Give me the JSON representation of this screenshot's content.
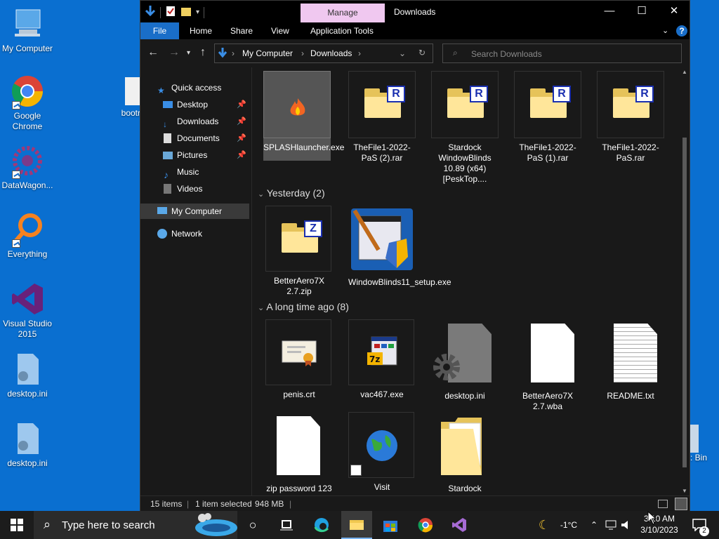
{
  "desktop": {
    "icons": [
      "My Computer",
      "Google Chrome",
      "DataWagon...",
      "Everything",
      "Visual Studio 2015",
      "desktop.ini",
      "desktop.ini"
    ],
    "partial_bootr": "bootr",
    "partial_bin": ": Bin"
  },
  "window": {
    "manage_tab": "Manage",
    "title": "Downloads",
    "ribbon_tabs": [
      "File",
      "Home",
      "Share",
      "View",
      "Application Tools"
    ],
    "breadcrumb": [
      "My Computer",
      "Downloads"
    ],
    "search_placeholder": "Search Downloads"
  },
  "nav": {
    "quick_access": "Quick access",
    "items": [
      "Desktop",
      "Downloads",
      "Documents",
      "Pictures",
      "Music",
      "Videos"
    ],
    "my_computer": "My Computer",
    "network": "Network"
  },
  "content": {
    "today_items": [
      "SPLASHlauncher.exe",
      "TheFile1-2022-PaS (2).rar",
      "Stardock WindowBlinds 10.89 (x64)[PeskTop....",
      "TheFile1-2022-PaS (1).rar",
      "TheFile1-2022-PaS.rar"
    ],
    "group_yesterday": "Yesterday (2)",
    "yesterday_items": [
      "BetterAero7X 2.7.zip",
      "WindowBlinds11_setup.exe"
    ],
    "group_longago": "A long time ago (8)",
    "longago_items": [
      "penis.crt",
      "vac467.exe",
      "desktop.ini",
      "BetterAero7X 2.7.wba",
      "README.txt",
      "zip password 123",
      "Visit",
      "Stardock"
    ],
    "badges": [
      "R",
      "R",
      "R",
      "R",
      "Z",
      "7z"
    ]
  },
  "status": {
    "items": "15 items",
    "selected": "1 item selected",
    "size": "948 MB"
  },
  "taskbar": {
    "search_placeholder": "Type here to search",
    "temperature": "-1°C",
    "time": "3:10 AM",
    "date": "3/10/2023",
    "notifications": "2"
  }
}
